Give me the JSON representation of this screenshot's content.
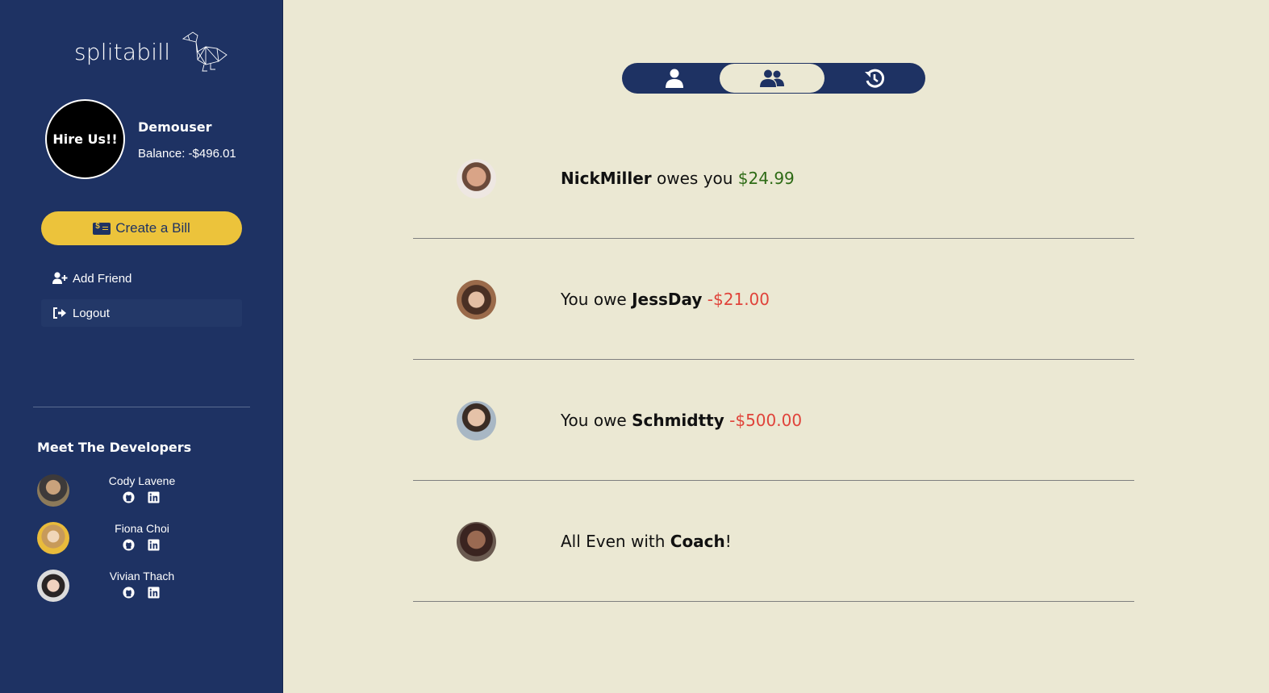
{
  "brand": {
    "name": "splitabill"
  },
  "profile": {
    "avatar_text": "Hire Us!!",
    "username": "Demouser",
    "balance": "Balance: -$496.01"
  },
  "actions": {
    "create_bill": "Create a Bill",
    "add_friend": "Add Friend",
    "logout": "Logout"
  },
  "developers": {
    "title": "Meet The Developers",
    "people": [
      {
        "name": "Cody Lavene"
      },
      {
        "name": "Fiona Choi"
      },
      {
        "name": "Vivian Thach"
      }
    ]
  },
  "tabs": [
    {
      "icon": "user-icon"
    },
    {
      "icon": "users-icon",
      "active": true
    },
    {
      "icon": "history-icon"
    }
  ],
  "friends": [
    {
      "pre": "",
      "name": "NickMiller",
      "mid": " owes you ",
      "amount": "$24.99",
      "post": "",
      "status": "owed"
    },
    {
      "pre": "You owe ",
      "name": "JessDay",
      "mid": " ",
      "amount": "-$21.00",
      "post": "",
      "status": "owe"
    },
    {
      "pre": "You owe ",
      "name": "Schmidtty",
      "mid": " ",
      "amount": "-$500.00",
      "post": "",
      "status": "owe"
    },
    {
      "pre": "All Even with ",
      "name": "Coach",
      "mid": "",
      "amount": "",
      "post": "!",
      "status": "even"
    }
  ],
  "colors": {
    "sidebar": "#1e3263",
    "background": "#ebe8d3",
    "accent": "#ecc33b",
    "positive": "#2e6b16",
    "negative": "#e0433a"
  }
}
